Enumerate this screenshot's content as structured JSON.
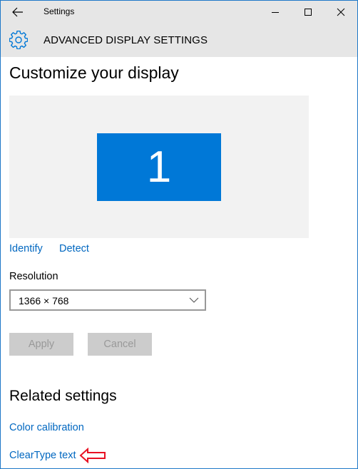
{
  "window": {
    "title": "Settings",
    "controls": {
      "minimize": "minimize",
      "maximize": "maximize",
      "close": "close"
    }
  },
  "header": {
    "title": "ADVANCED DISPLAY SETTINGS",
    "icon": "gear-icon"
  },
  "main": {
    "title": "Customize your display",
    "display_preview": {
      "monitor_number": "1",
      "accent_color": "#0078d7"
    },
    "links": {
      "identify": "Identify",
      "detect": "Detect"
    },
    "resolution": {
      "label": "Resolution",
      "value": "1366 × 768"
    },
    "buttons": {
      "apply": "Apply",
      "cancel": "Cancel",
      "disabled": true
    }
  },
  "related": {
    "title": "Related settings",
    "links": [
      "Color calibration",
      "ClearType text"
    ]
  },
  "annotation": {
    "type": "red-arrow",
    "target": "ClearType text",
    "color": "#e81123"
  }
}
